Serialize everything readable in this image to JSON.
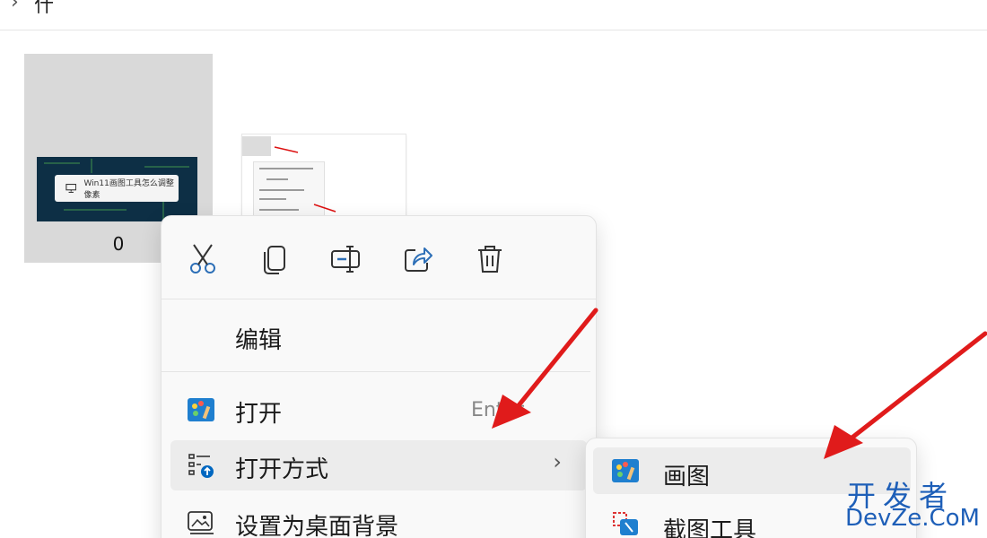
{
  "header": {
    "chevron": "›",
    "crumb": "什"
  },
  "files": [
    {
      "name": "0",
      "selected": true,
      "thumb_text": "Win11画图工具怎么调整像素",
      "thumb_icon": "monitor-icon"
    },
    {
      "name": "",
      "selected": false,
      "thumb_text": "编辑 打开 打开方式 设置为桌面背景"
    }
  ],
  "context_menu": {
    "toolbar": [
      {
        "name": "cut",
        "icon": "scissors-icon"
      },
      {
        "name": "copy",
        "icon": "copy-icon"
      },
      {
        "name": "rename",
        "icon": "rename-icon"
      },
      {
        "name": "share",
        "icon": "share-icon"
      },
      {
        "name": "delete",
        "icon": "trash-icon"
      }
    ],
    "items": [
      {
        "label": "编辑",
        "shortcut": "",
        "icon": ""
      },
      {
        "label": "打开",
        "shortcut": "Enter",
        "icon": "paint-app-icon"
      },
      {
        "label": "打开方式",
        "shortcut": "",
        "icon": "open-with-icon",
        "submenu_arrow": "›",
        "highlighted": true
      },
      {
        "label": "设置为桌面背景",
        "shortcut": "",
        "icon": "wallpaper-icon"
      }
    ]
  },
  "submenu": {
    "items": [
      {
        "label": "画图",
        "icon": "paint-app-icon",
        "highlighted": true
      },
      {
        "label": "截图工具",
        "icon": "snipping-tool-icon"
      }
    ]
  },
  "watermark": {
    "line1": "开发者",
    "line2": "DevZe.CoM"
  },
  "colors": {
    "arrow": "#e01b1b",
    "accent": "#0067c0",
    "watermark": "#1e5fb8"
  }
}
